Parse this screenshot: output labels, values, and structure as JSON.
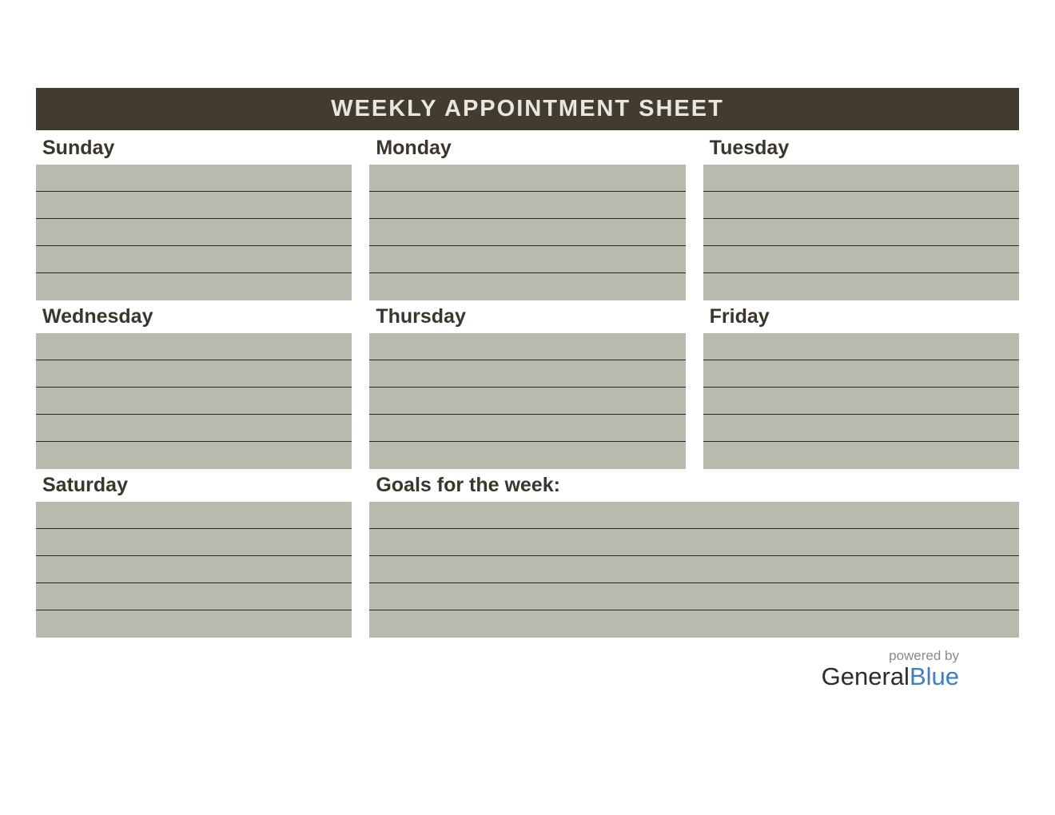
{
  "title": "WEEKLY APPOINTMENT SHEET",
  "days": {
    "sunday": "Sunday",
    "monday": "Monday",
    "tuesday": "Tuesday",
    "wednesday": "Wednesday",
    "thursday": "Thursday",
    "friday": "Friday",
    "saturday": "Saturday"
  },
  "goals_label": "Goals for the week:",
  "footer": {
    "powered_by": "powered by",
    "brand_part1": "General",
    "brand_part2": "Blue"
  },
  "colors": {
    "title_bg": "#423c2f",
    "title_text": "#e8e6df",
    "cell_bg": "#b6bbae",
    "label_text": "#3a362c",
    "brand_blue": "#3d7ec9"
  },
  "rows_per_block": 5
}
